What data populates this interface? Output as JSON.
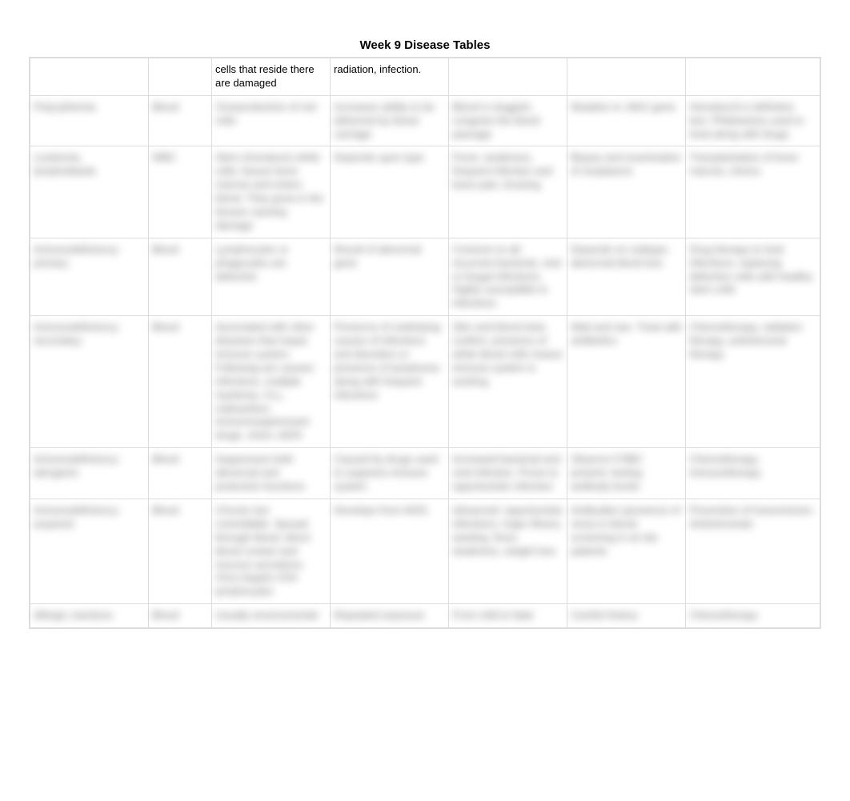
{
  "title": "Week 9 Disease Tables",
  "rows": [
    {
      "c1": "",
      "c2": "",
      "c3": "cells that reside there are damaged",
      "c4": "radiation, infection.",
      "c5": "",
      "c6": "",
      "c7": ""
    },
    {
      "c1": "Polycythemia",
      "c2": "Blood",
      "c3": "Overproduction of red cells",
      "c4": "Increases ability to be delivered by blood carriage",
      "c5": "Blood is sluggish, congests the blood passage",
      "c6": "Mutation in JAK2 gene",
      "c7": "Hematocrit is definitive test. Phlebotomy used to treat along with drugs"
    },
    {
      "c1": "Leukemia; lymphoblastic",
      "c2": "WBC",
      "c3": "Stem (immature) white cells; leaves bone marrow and enters blood. They grow in the tissues causing damage",
      "c4": "Depends upon type",
      "c5": "Fever, weakness, frequent infection and bone pain, bruising",
      "c6": "Biopsy and examination of neoplasms",
      "c7": "Transplantation of bone marrow, chemo"
    },
    {
      "c1": "Immunodeficiency: primary",
      "c2": "Blood",
      "c3": "Lymphocytes or phagocytes are defective",
      "c4": "Result of abnormal gene",
      "c5": "Common to all; recurrent bacterial, viral or fungal infections. Highly susceptible to infections",
      "c6": "Depends on subtype; abnormal blood test",
      "c7": "Drug therapy to heal infections; replacing defective cells with healthy stem cells"
    },
    {
      "c1": "Immunodeficiency: secondary",
      "c2": "Blood",
      "c3": "Associated with other diseases that impair immune system. Following are causes: infections, multiple myeloma, CLL, malnutrition, immunosuppressant drugs, chem, AIDS",
      "c4": "Presence of underlying causes of infections and disorders or presence of lymphoma along with frequent infections",
      "c5": "Skin and blood tests confirm; presence of white blood cells means immune system is working",
      "c6": "Wait and see. Treat with antibiotics",
      "c7": "Chemotherapy, radiation therapy, antiretroviral therapy"
    },
    {
      "c1": "Immunodeficiency: iatrogenic",
      "c2": "Blood",
      "c3": "Suppresses both abnormal and protective functions",
      "c4": "Caused by drugs used to suppress immune system",
      "c5": "Increased bacterial and viral infection. Prone to opportunistic infection",
      "c6": "Observe if RBC present; testing antibody levels",
      "c7": "Chemotherapy, immunotherapy"
    },
    {
      "c1": "Immunodeficiency: acquired",
      "c2": "Blood",
      "c3": "Chronic but controllable. Spread through blood; direct blood contact and mucous secretions. Virus targets CD4 lymphocytes",
      "c4": "Develops from AIDS",
      "c5": "Advanced: opportunistic infections; major illness, wasting, fever, weakness, weight loss",
      "c6": "Antibodies (presence of virus) in blood; screening in at risk patients",
      "c7": "Prevention of transmission. Antiretrovirals"
    },
    {
      "c1": "Allergic reactions",
      "c2": "Blood",
      "c3": "Usually environmental",
      "c4": "Repeated exposure",
      "c5": "From mild to fatal",
      "c6": "Careful history",
      "c7": "Chemotherapy"
    }
  ]
}
